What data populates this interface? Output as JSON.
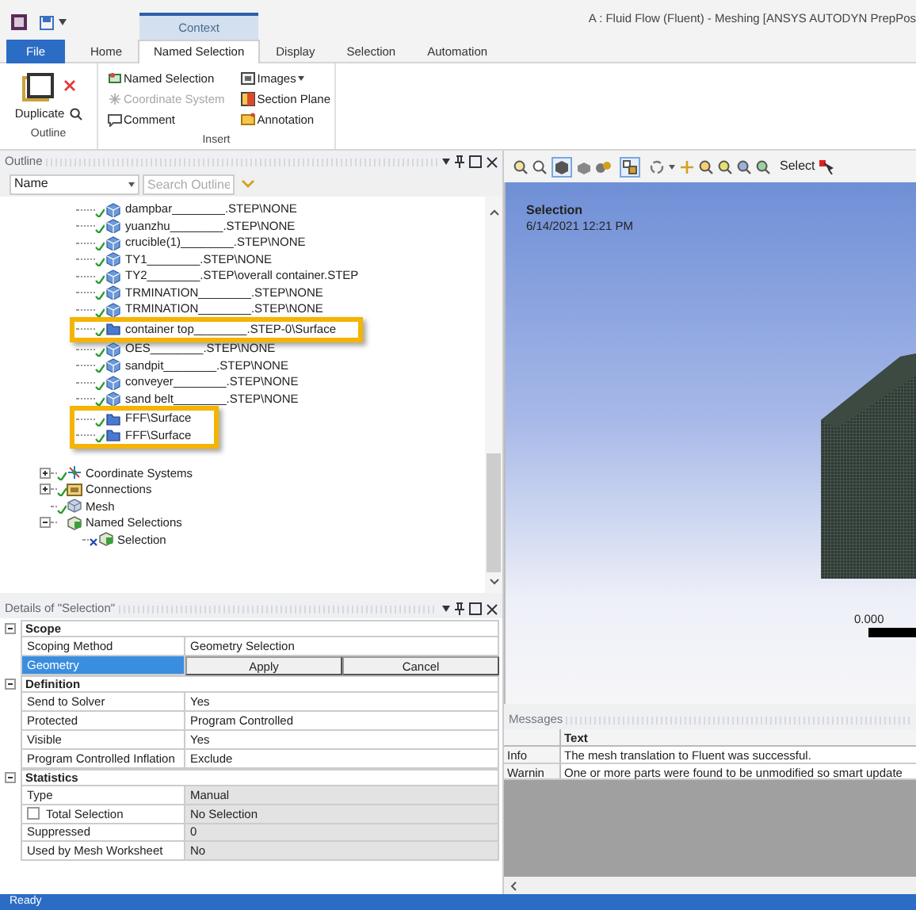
{
  "window": {
    "title": "A : Fluid Flow (Fluent) - Meshing [ANSYS AUTODYN PrepPos",
    "context_tab": "Context"
  },
  "ribbon_tabs": [
    {
      "label": "File",
      "kind": "file",
      "selected": false
    },
    {
      "label": "Home",
      "kind": "tab",
      "selected": false
    },
    {
      "label": "Named Selection",
      "kind": "tab",
      "selected": true
    },
    {
      "label": "Display",
      "kind": "tab",
      "selected": false
    },
    {
      "label": "Selection",
      "kind": "tab",
      "selected": false
    },
    {
      "label": "Automation",
      "kind": "tab",
      "selected": false
    }
  ],
  "ribbon_groups": [
    {
      "label": "Outline",
      "big_button": "Duplicate"
    },
    {
      "label": "Insert",
      "items": [
        {
          "label": "Named Selection",
          "disabled": false
        },
        {
          "label": "Coordinate System",
          "disabled": true
        },
        {
          "label": "Comment",
          "disabled": false
        },
        {
          "label": "Images",
          "disabled": false,
          "dropdown": true
        },
        {
          "label": "Section Plane",
          "disabled": false
        },
        {
          "label": "Annotation",
          "disabled": false
        }
      ]
    }
  ],
  "outline": {
    "title": "Outline",
    "column_dropdown": "Name",
    "search_placeholder": "Search Outline",
    "parts": [
      {
        "label": "dampbar________.STEP\\NONE",
        "kind": "body",
        "highlighted": false
      },
      {
        "label": "yuanzhu________.STEP\\NONE",
        "kind": "body",
        "highlighted": false
      },
      {
        "label": "crucible(1)________.STEP\\NONE",
        "kind": "body",
        "highlighted": false
      },
      {
        "label": "TY1________.STEP\\NONE",
        "kind": "body",
        "highlighted": false
      },
      {
        "label": "TY2________.STEP\\overall container.STEP",
        "kind": "body",
        "highlighted": false
      },
      {
        "label": "TRMINATION________.STEP\\NONE",
        "kind": "body",
        "highlighted": false
      },
      {
        "label": "TRMINATION________.STEP\\NONE",
        "kind": "body",
        "highlighted": false
      },
      {
        "label": "container top________.STEP-0\\Surface",
        "kind": "surface",
        "highlighted": true
      },
      {
        "label": "OES________.STEP\\NONE",
        "kind": "body",
        "highlighted": false
      },
      {
        "label": "sandpit________.STEP\\NONE",
        "kind": "body",
        "highlighted": false
      },
      {
        "label": "conveyer________.STEP\\NONE",
        "kind": "body",
        "highlighted": false
      },
      {
        "label": "sand belt________.STEP\\NONE",
        "kind": "body",
        "highlighted": false
      },
      {
        "label": "FFF\\Surface",
        "kind": "surface",
        "highlighted": true
      },
      {
        "label": "FFF\\Surface",
        "kind": "surface",
        "highlighted": true
      }
    ],
    "nodes": [
      {
        "label": "Coordinate Systems",
        "kind": "coord",
        "expanded": false,
        "checked": true
      },
      {
        "label": "Connections",
        "kind": "connections",
        "expanded": false,
        "checked": true
      },
      {
        "label": "Mesh",
        "kind": "mesh",
        "checked": true
      },
      {
        "label": "Named Selections",
        "kind": "named",
        "expanded": true,
        "children": [
          {
            "label": "Selection",
            "kind": "named",
            "checked": false
          }
        ]
      }
    ]
  },
  "details": {
    "title": "Details of \"Selection\"",
    "sections": [
      {
        "label": "Scope",
        "expanded": true,
        "rows": [
          {
            "kind": "value",
            "label": "Scoping Method",
            "value": "Geometry Selection",
            "readonly": false,
            "selected": false
          },
          {
            "kind": "buttons",
            "label": "Geometry",
            "buttons": [
              "Apply",
              "Cancel"
            ],
            "selected": true
          }
        ]
      },
      {
        "label": "Definition",
        "expanded": true,
        "rows": [
          {
            "kind": "value",
            "label": "Send to Solver",
            "value": "Yes",
            "readonly": false,
            "selected": false
          },
          {
            "kind": "value",
            "label": "Protected",
            "value": "Program Controlled",
            "readonly": false,
            "selected": false
          },
          {
            "kind": "value",
            "label": "Visible",
            "value": "Yes",
            "readonly": false,
            "selected": false
          },
          {
            "kind": "value",
            "label": "Program Controlled Inflation",
            "value": "Exclude",
            "readonly": false,
            "selected": false
          }
        ]
      },
      {
        "label": "Statistics",
        "expanded": true,
        "rows": [
          {
            "kind": "value",
            "label": "Type",
            "value": "Manual",
            "readonly": true,
            "selected": false
          },
          {
            "kind": "checkbox",
            "label": "Total Selection",
            "value": "No Selection",
            "checked": false,
            "readonly": true,
            "selected": false
          },
          {
            "kind": "value",
            "label": "Suppressed",
            "value": "0",
            "readonly": true,
            "selected": false
          },
          {
            "kind": "value",
            "label": "Used by Mesh Worksheet",
            "value": "No",
            "readonly": true,
            "selected": false
          }
        ]
      }
    ]
  },
  "toolbar": {
    "select_label": "Select"
  },
  "viewport": {
    "title": "Selection",
    "date": "6/14/2021 12:21 PM",
    "scale_label": "0.000"
  },
  "messages": {
    "title": "Messages",
    "column": "Text",
    "rows": [
      {
        "type": "Info",
        "text": "The mesh translation to Fluent was successful."
      },
      {
        "type": "Warnin",
        "text": "One or more parts were found to be unmodified so smart update"
      }
    ]
  },
  "status_bar": "Ready"
}
